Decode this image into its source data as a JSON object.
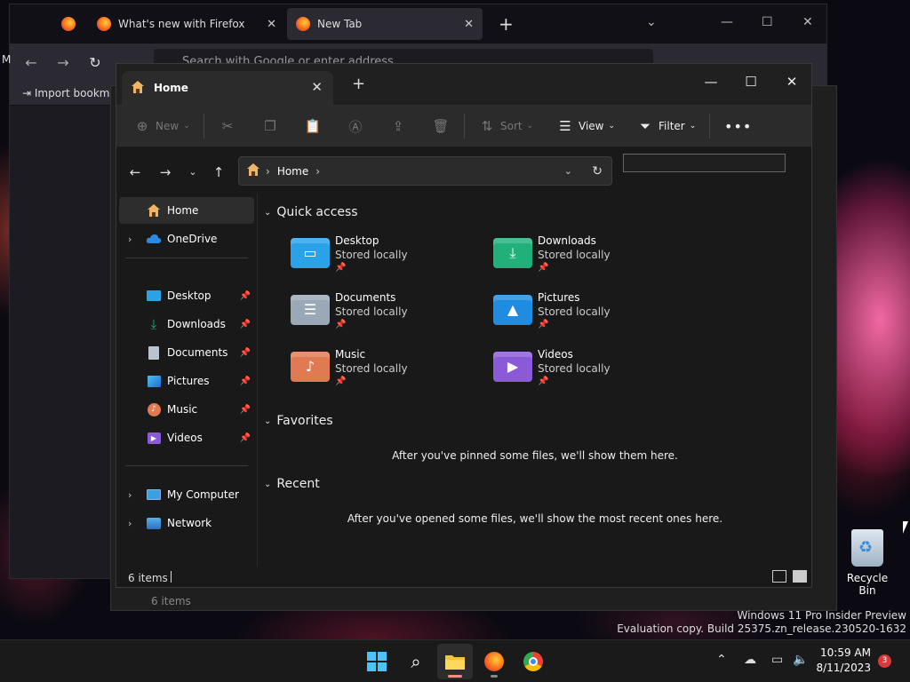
{
  "firefox": {
    "tabs": [
      {
        "label": "What's new with Firefox"
      },
      {
        "label": "New Tab"
      }
    ],
    "url_placeholder": "Search with Google or enter address",
    "bookmark_label": "Import bookmarks...",
    "left_edge_label": "M"
  },
  "explorer": {
    "tab_title": "Home",
    "toolbar": {
      "new_label": "New",
      "sort_label": "Sort",
      "view_label": "View",
      "filter_label": "Filter"
    },
    "breadcrumb": [
      "Home"
    ],
    "sidebar": {
      "home": "Home",
      "onedrive": "OneDrive",
      "pinned": [
        {
          "label": "Desktop"
        },
        {
          "label": "Downloads"
        },
        {
          "label": "Documents"
        },
        {
          "label": "Pictures"
        },
        {
          "label": "Music"
        },
        {
          "label": "Videos"
        }
      ],
      "my_computer": "My Computer",
      "network": "Network"
    },
    "sections": {
      "quick_access": "Quick access",
      "favorites": "Favorites",
      "recent": "Recent"
    },
    "quick_access_items": [
      {
        "name": "Desktop",
        "status": "Stored locally",
        "color": "#2aa2e8"
      },
      {
        "name": "Downloads",
        "status": "Stored locally",
        "color": "#22b07a"
      },
      {
        "name": "Documents",
        "status": "Stored locally",
        "color": "#9aa8b8"
      },
      {
        "name": "Pictures",
        "status": "Stored locally",
        "color": "#1e8ce0"
      },
      {
        "name": "Music",
        "status": "Stored locally",
        "color": "#e07a52"
      },
      {
        "name": "Videos",
        "status": "Stored locally",
        "color": "#8a5ad8"
      }
    ],
    "favorites_empty": "After you've pinned some files, we'll show them here.",
    "recent_empty": "After you've opened some files, we'll show the most recent ones here.",
    "status_items": "6 items"
  },
  "desktop": {
    "recycle_bin": "Recycle Bin",
    "watermark_line1": "Windows 11 Pro Insider Preview",
    "watermark_line2": "Evaluation copy. Build 25375.zn_release.230520-1632",
    "ghost_status": "6 items"
  },
  "taskbar": {
    "time": "10:59 AM",
    "date": "8/11/2023",
    "notification_count": "3"
  }
}
